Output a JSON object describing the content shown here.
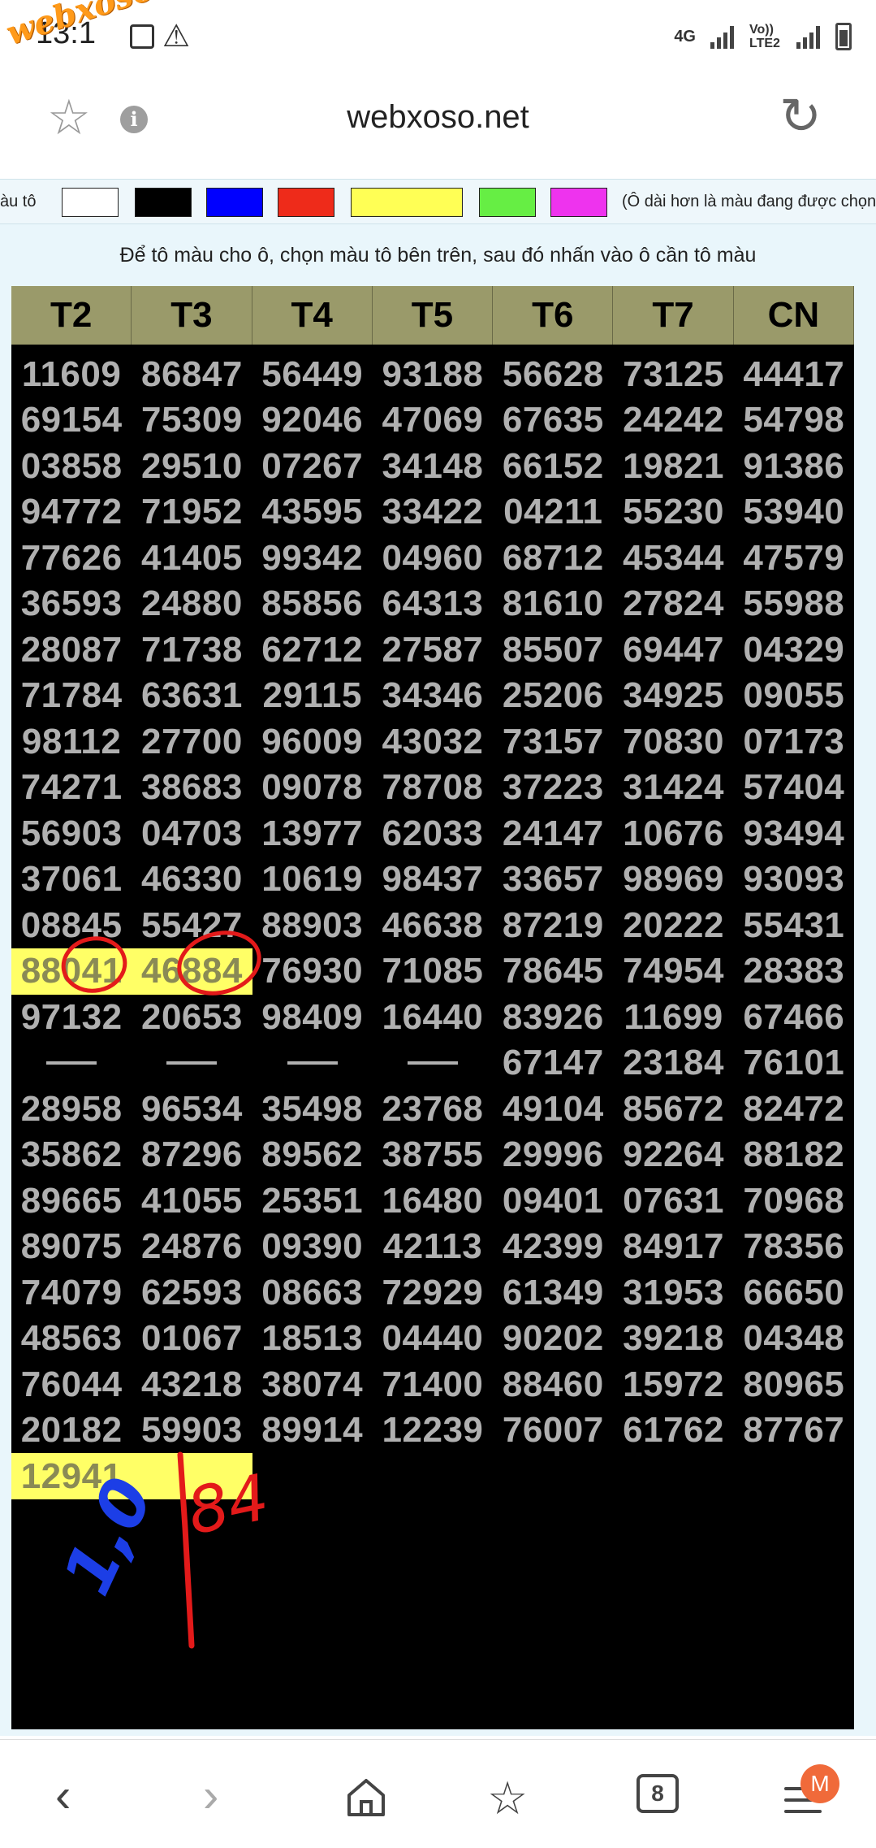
{
  "status_bar": {
    "time": "13:1",
    "watermark": "webxoso.net",
    "network_label": "4G",
    "volte_label": "Vo)) LTE2"
  },
  "url_bar": {
    "url": "webxoso.net",
    "icons": [
      "star-icon",
      "info-icon",
      "reload-icon"
    ]
  },
  "palette": {
    "label": "àu tô",
    "swatches": [
      "#ffffff",
      "#000000",
      "#0000ff",
      "#ee2b1a",
      "#ffff55",
      "#66ee44",
      "#ee33ee"
    ],
    "note": "(Ô dài hơn là màu đang được chọn)"
  },
  "instruction": "Để tô màu cho ô, chọn màu tô bên trên, sau đó nhấn vào ô cần tô màu",
  "table": {
    "headers": [
      "T2",
      "T3",
      "T4",
      "T5",
      "T6",
      "T7",
      "CN"
    ],
    "rows": [
      [
        "11609",
        "86847",
        "56449",
        "93188",
        "56628",
        "73125",
        "44417"
      ],
      [
        "69154",
        "75309",
        "92046",
        "47069",
        "67635",
        "24242",
        "54798"
      ],
      [
        "03858",
        "29510",
        "07267",
        "34148",
        "66152",
        "19821",
        "91386"
      ],
      [
        "94772",
        "71952",
        "43595",
        "33422",
        "04211",
        "55230",
        "53940"
      ],
      [
        "77626",
        "41405",
        "99342",
        "04960",
        "68712",
        "45344",
        "47579"
      ],
      [
        "36593",
        "24880",
        "85856",
        "64313",
        "81610",
        "27824",
        "55988"
      ],
      [
        "28087",
        "71738",
        "62712",
        "27587",
        "85507",
        "69447",
        "04329"
      ],
      [
        "71784",
        "63631",
        "29115",
        "34346",
        "25206",
        "34925",
        "09055"
      ],
      [
        "98112",
        "27700",
        "96009",
        "43032",
        "73157",
        "70830",
        "07173"
      ],
      [
        "74271",
        "38683",
        "09078",
        "78708",
        "37223",
        "31424",
        "57404"
      ],
      [
        "56903",
        "04703",
        "13977",
        "62033",
        "24147",
        "10676",
        "93494"
      ],
      [
        "37061",
        "46330",
        "10619",
        "98437",
        "33657",
        "98969",
        "93093"
      ],
      [
        "08845",
        "55427",
        "88903",
        "46638",
        "87219",
        "20222",
        "55431"
      ],
      [
        "88041",
        "46884",
        "76930",
        "71085",
        "78645",
        "74954",
        "28383"
      ],
      [
        "97132",
        "20653",
        "98409",
        "16440",
        "83926",
        "11699",
        "67466"
      ],
      [
        "—",
        "—",
        "—",
        "—",
        "67147",
        "23184",
        "76101"
      ],
      [
        "28958",
        "96534",
        "35498",
        "23768",
        "49104",
        "85672",
        "82472"
      ],
      [
        "35862",
        "87296",
        "89562",
        "38755",
        "29996",
        "92264",
        "88182"
      ],
      [
        "89665",
        "41055",
        "25351",
        "16480",
        "09401",
        "07631",
        "70968"
      ],
      [
        "89075",
        "24876",
        "09390",
        "42113",
        "42399",
        "84917",
        "78356"
      ],
      [
        "74079",
        "62593",
        "08663",
        "72929",
        "61349",
        "31953",
        "66650"
      ],
      [
        "48563",
        "01067",
        "18513",
        "04440",
        "90202",
        "39218",
        "04348"
      ],
      [
        "76044",
        "43218",
        "38074",
        "71400",
        "88460",
        "15972",
        "80965"
      ],
      [
        "20182",
        "59903",
        "89914",
        "12239",
        "76007",
        "61762",
        "87767"
      ],
      [
        "12941",
        "",
        "",
        "",
        "",
        "",
        ""
      ]
    ],
    "highlighted": [
      [
        13,
        0
      ],
      [
        13,
        1
      ],
      [
        24,
        0
      ],
      [
        24,
        1
      ]
    ],
    "highlight_color": "#ffff66",
    "cell_text_color": "#b0b0b0",
    "header_color": "#9a9a6a"
  },
  "handwriting": {
    "blue_note": "1,0",
    "red_note": "84"
  },
  "bottom_nav": {
    "tab_count": "8",
    "avatar_letter": "M",
    "icons": [
      "back-icon",
      "forward-icon",
      "home-icon",
      "bookmarks-icon",
      "tabs-icon",
      "menu-icon"
    ]
  }
}
